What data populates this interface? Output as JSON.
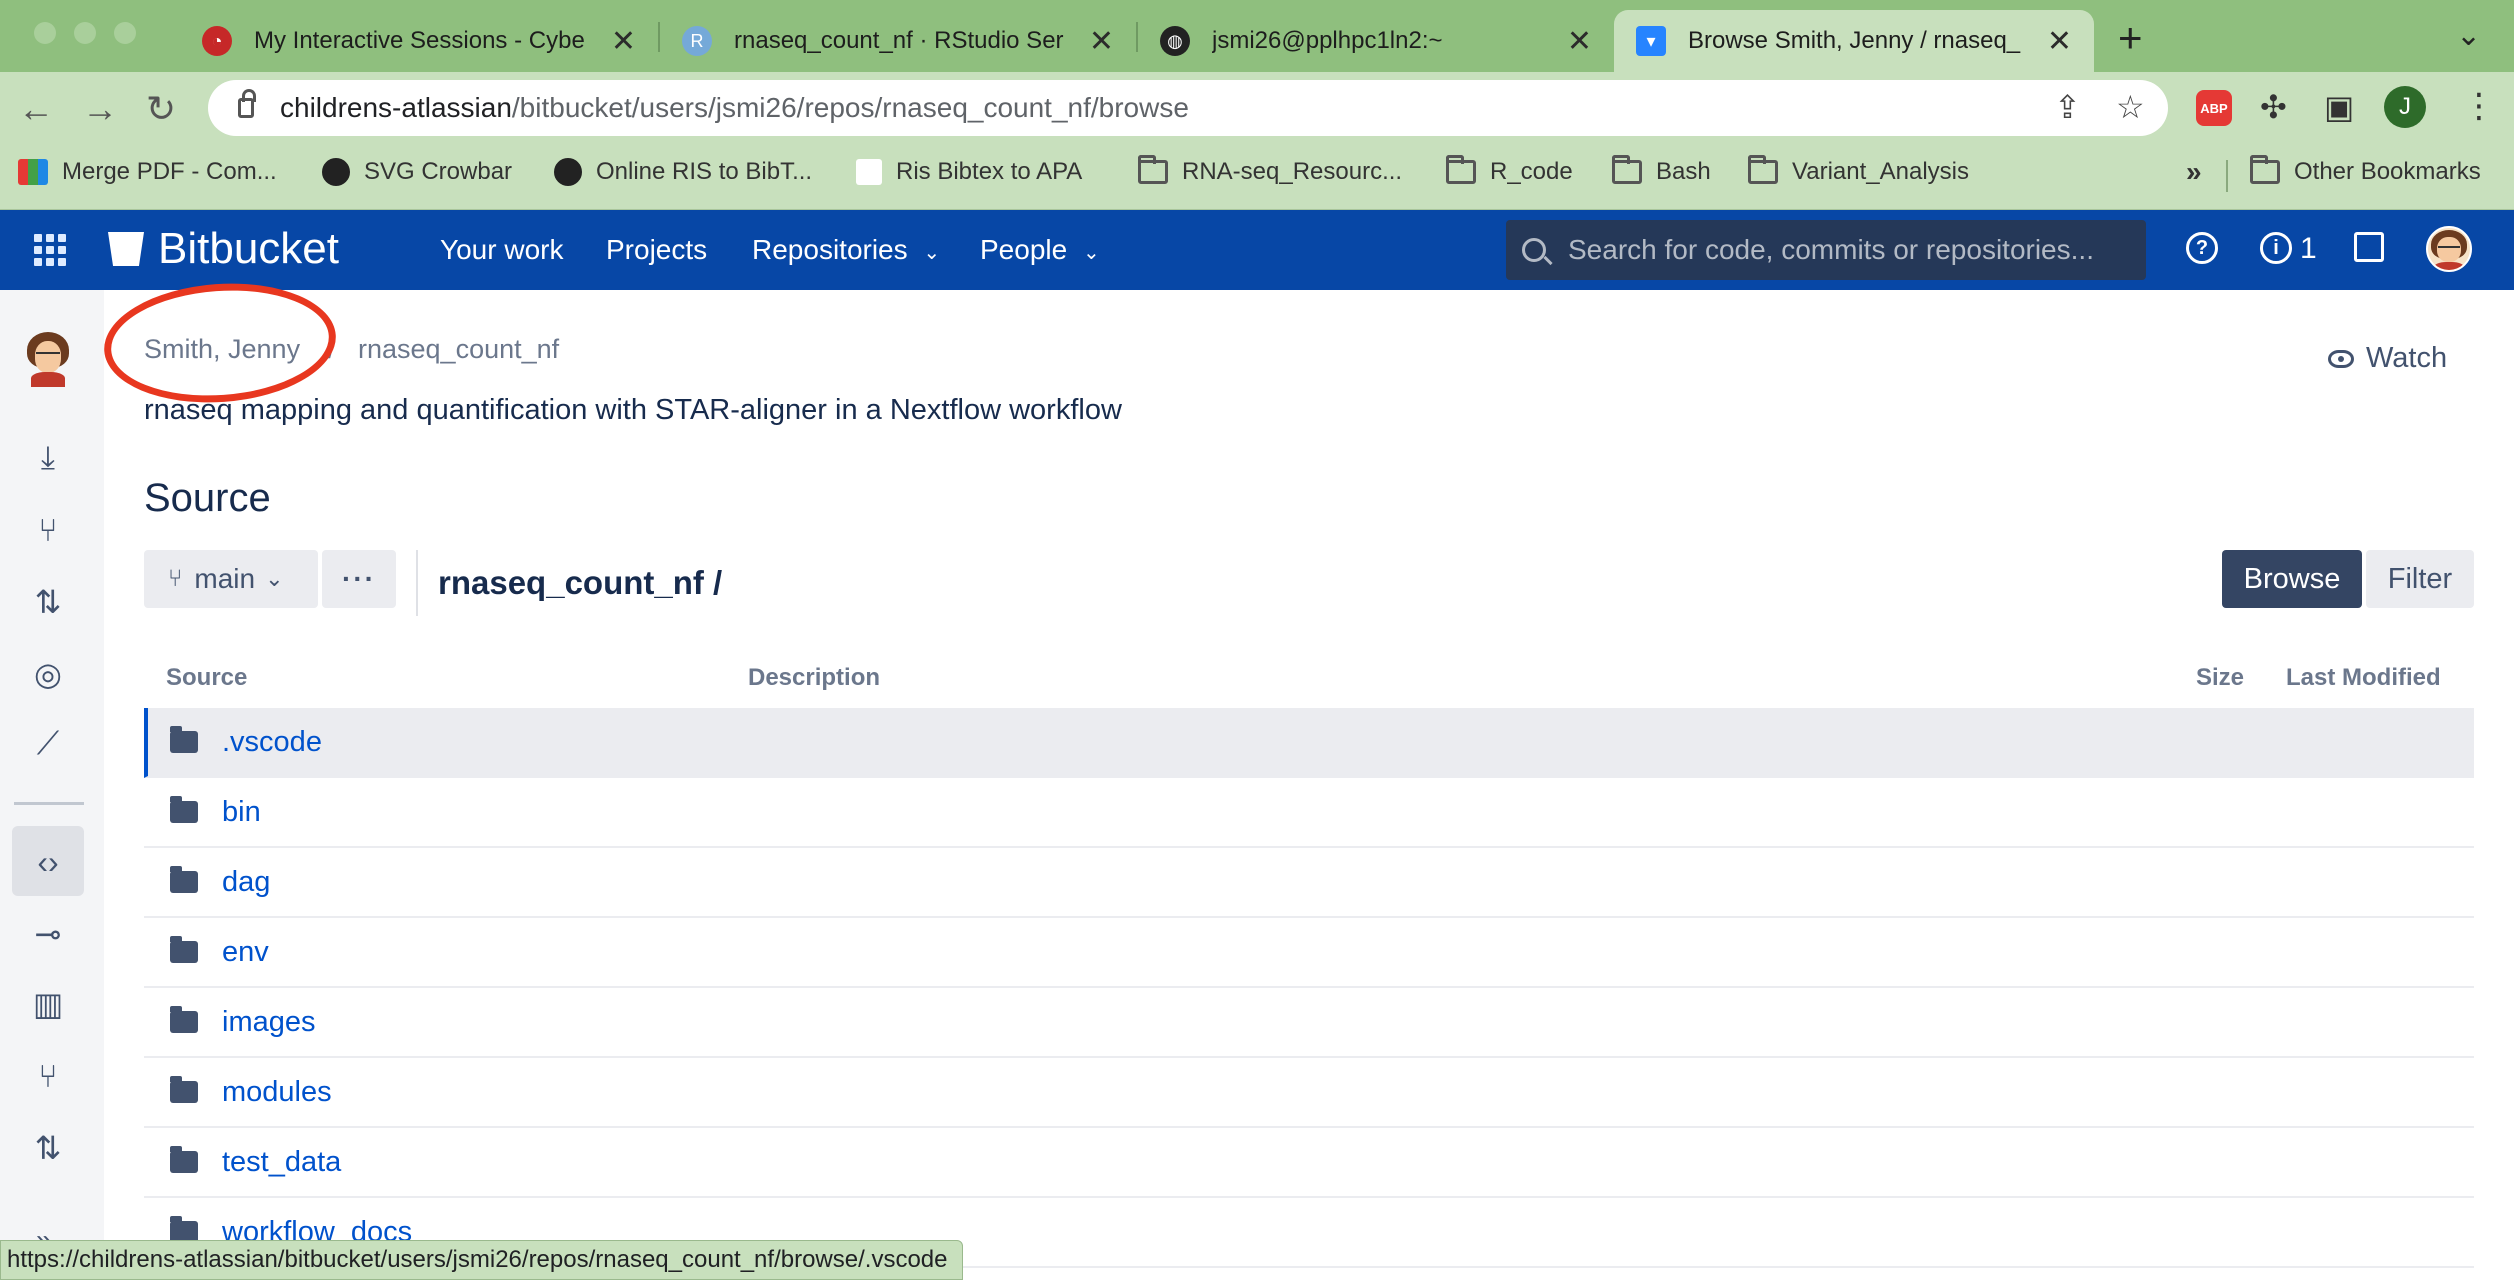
{
  "browser": {
    "tabs": [
      {
        "title": "My Interactive Sessions - Cybe",
        "icon": "cyber-icon",
        "active": false
      },
      {
        "title": "rnaseq_count_nf · RStudio Ser",
        "icon": "rstudio-icon",
        "active": false
      },
      {
        "title": "jsmi26@pplhpc1ln2:~",
        "icon": "globe-icon",
        "active": false
      },
      {
        "title": "Browse Smith, Jenny / rnaseq_",
        "icon": "bitbucket-icon",
        "active": true
      }
    ],
    "tab_close": "✕",
    "new_tab": "+",
    "url_host": "childrens-atlassian",
    "url_path": "/bitbucket/users/jsmi26/repos/rnaseq_count_nf/browse",
    "abp_label": "ABP",
    "profile_initial": "J",
    "bookmarks": [
      {
        "label": "Merge PDF - Com...",
        "icon": "merge-pdf-icon"
      },
      {
        "label": "SVG Crowbar",
        "icon": "globe-icon"
      },
      {
        "label": "Online RIS to BibT...",
        "icon": "globe-icon"
      },
      {
        "label": "Ris Bibtex to APA",
        "icon": "ris-icon"
      },
      {
        "label": "RNA-seq_Resourc...",
        "icon": "folder-icon"
      },
      {
        "label": "R_code",
        "icon": "folder-icon"
      },
      {
        "label": "Bash",
        "icon": "folder-icon"
      },
      {
        "label": "Variant_Analysis",
        "icon": "folder-icon"
      }
    ],
    "bookmarks_more": "»",
    "other_bookmarks": "Other Bookmarks",
    "status_url": "https://childrens-atlassian/bitbucket/users/jsmi26/repos/rnaseq_count_nf/browse/.vscode"
  },
  "header": {
    "brand": "Bitbucket",
    "nav": {
      "your_work": "Your work",
      "projects": "Projects",
      "repositories": "Repositories",
      "people": "People"
    },
    "search_placeholder": "Search for code, commits or repositories...",
    "notifications_count": "1",
    "colors": {
      "header_bg": "#0747a6",
      "accent": "#0052cc"
    }
  },
  "breadcrumb": {
    "owner": "Smith, Jenny",
    "separator": "/",
    "repo": "rnaseq_count_nf"
  },
  "repo": {
    "description": "rnaseq mapping and quantification with STAR-aligner in a Nextflow workflow",
    "watch_label": "Watch",
    "section_title": "Source",
    "branch": "main",
    "more_label": "···",
    "path": "rnaseq_count_nf /",
    "browse_label": "Browse",
    "filter_label": "Filter"
  },
  "table": {
    "columns": {
      "source": "Source",
      "description": "Description",
      "size": "Size",
      "last_modified": "Last Modified"
    },
    "rows": [
      {
        "name": ".vscode",
        "type": "folder"
      },
      {
        "name": "bin",
        "type": "folder"
      },
      {
        "name": "dag",
        "type": "folder"
      },
      {
        "name": "env",
        "type": "folder"
      },
      {
        "name": "images",
        "type": "folder"
      },
      {
        "name": "modules",
        "type": "folder"
      },
      {
        "name": "test_data",
        "type": "folder"
      },
      {
        "name": "workflow_docs",
        "type": "folder"
      }
    ]
  },
  "annotation": {
    "color": "#e8371f"
  }
}
